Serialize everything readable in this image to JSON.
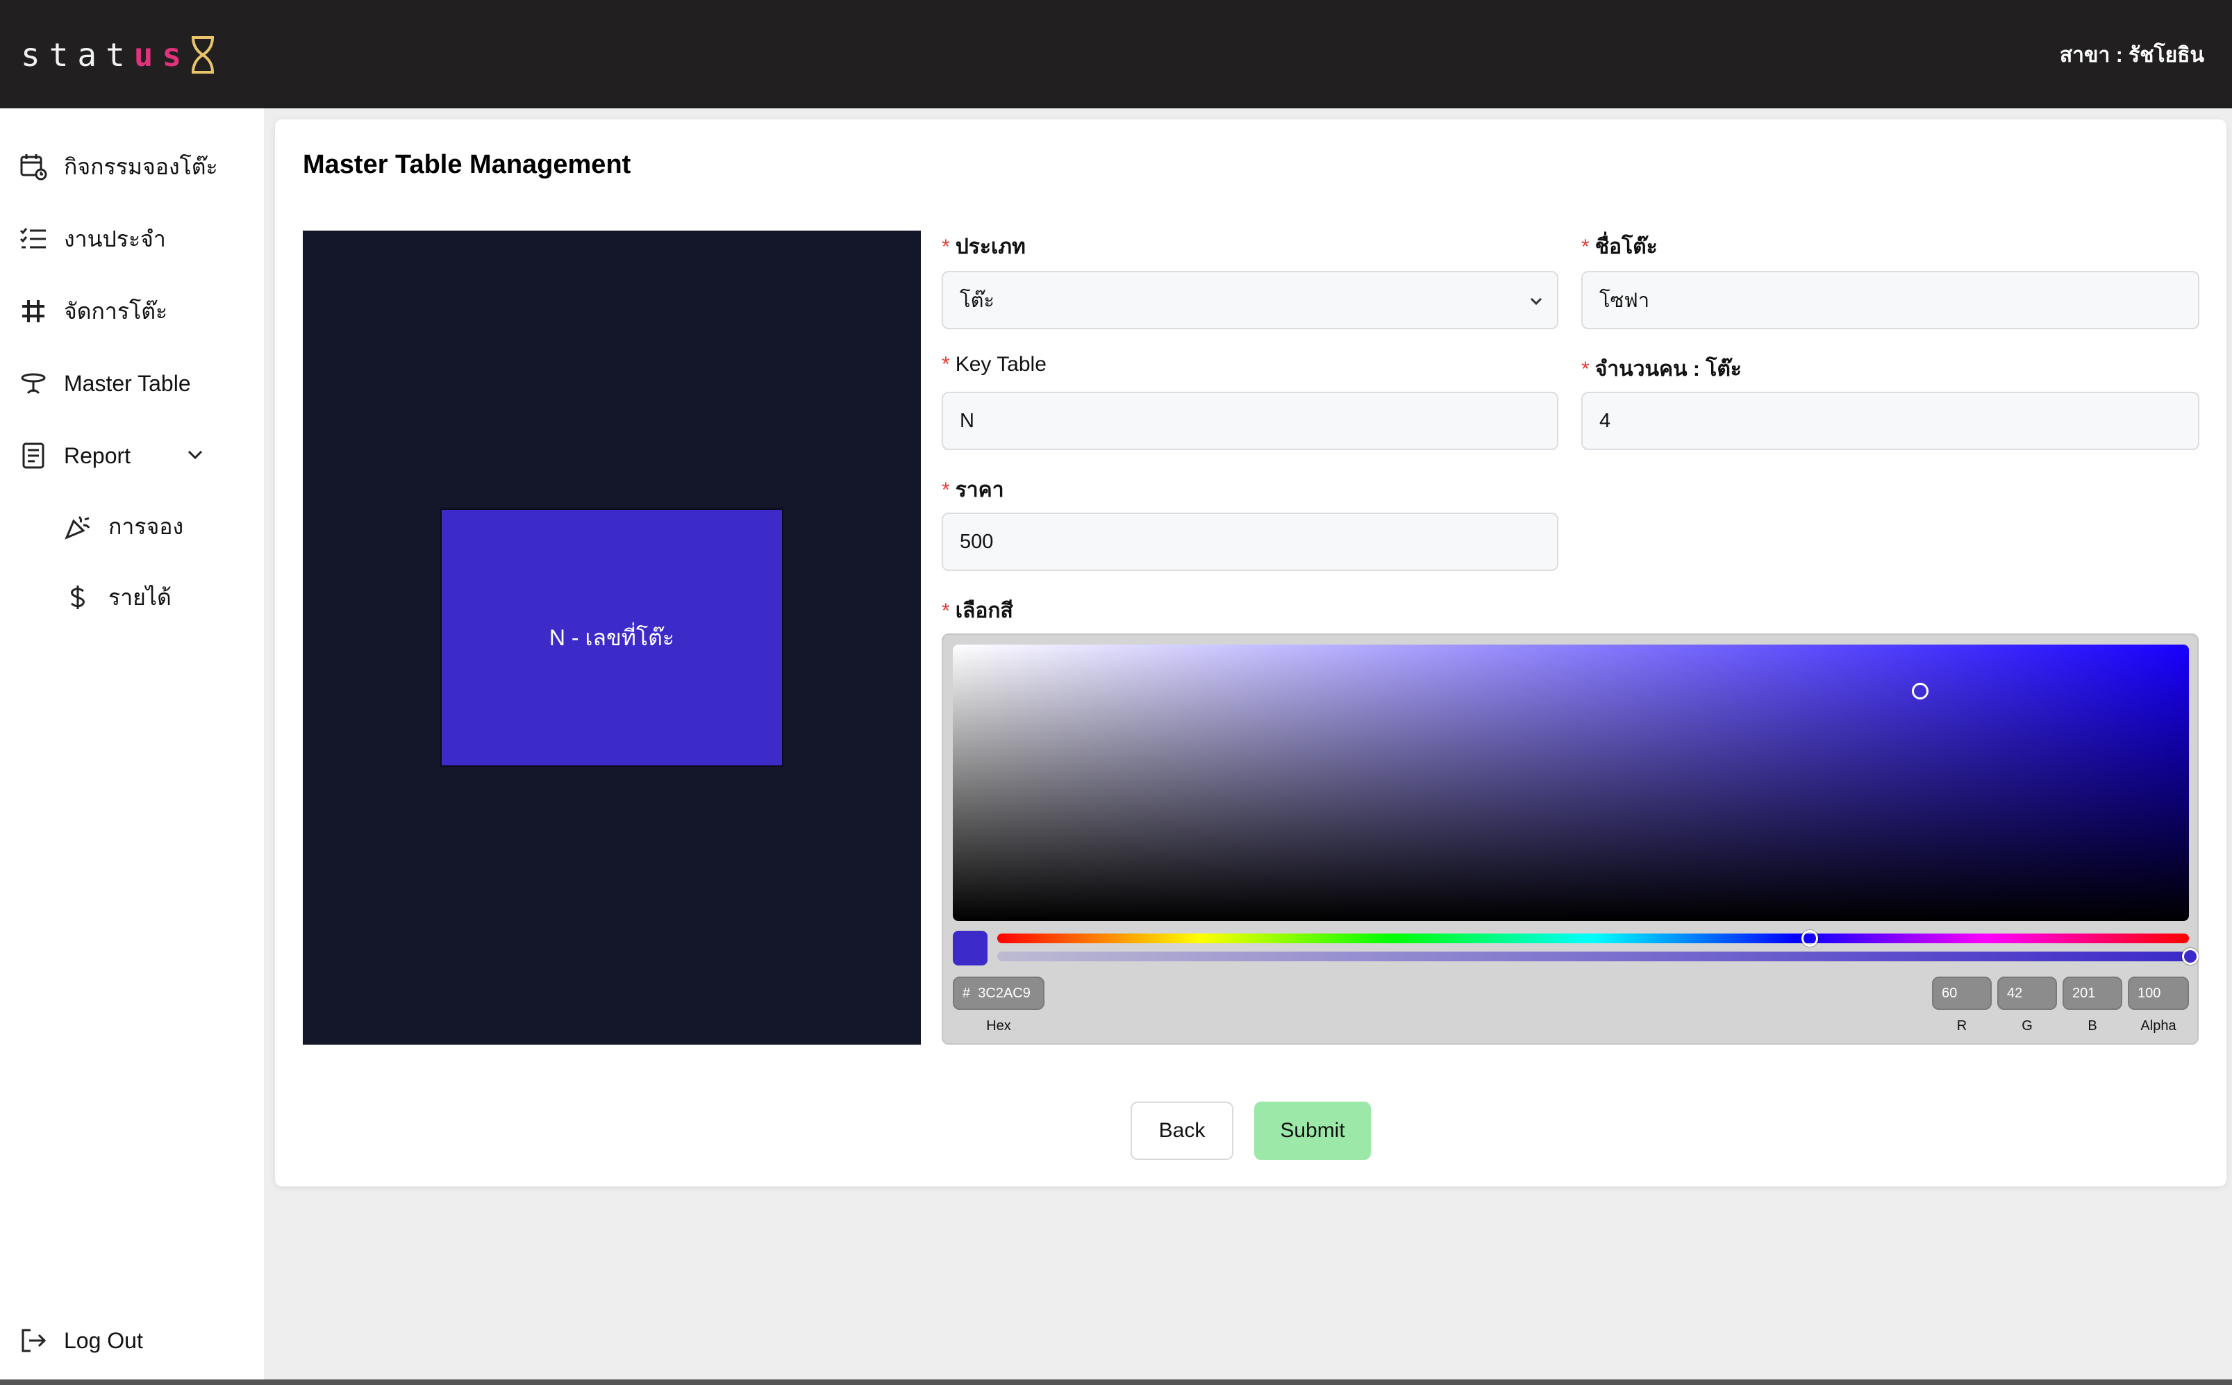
{
  "brand": {
    "logo_text_plain": "stat",
    "logo_text_accent": "us"
  },
  "header": {
    "branch": "สาขา : รัชโยธิน"
  },
  "sidebar": {
    "items": [
      {
        "label": "กิจกรรมจองโต๊ะ",
        "icon": "calendar-clock-icon"
      },
      {
        "label": "งานประจำ",
        "icon": "checklist-icon"
      },
      {
        "label": "จัดการโต๊ะ",
        "icon": "grid-icon"
      },
      {
        "label": "Master Table",
        "icon": "table-icon"
      },
      {
        "label": "Report",
        "icon": "report-icon"
      }
    ],
    "report_sub": [
      {
        "label": "การจอง",
        "icon": "party-popper-icon"
      },
      {
        "label": "รายได้",
        "icon": "dollar-icon"
      }
    ],
    "logout": "Log Out"
  },
  "page": {
    "title": "Master Table Management",
    "preview": {
      "label": "N - เลขที่โต๊ะ",
      "color": "#3c2ac9",
      "background": "#131729"
    },
    "form": {
      "type_label": "ประเภท",
      "type_value": "โต๊ะ",
      "name_label": "ชื่อโต๊ะ",
      "name_value": "โซฟา",
      "key_label": "Key Table",
      "key_value": "N",
      "capacity_label": "จำนวนคน : โต๊ะ",
      "capacity_value": "4",
      "price_label": "ราคา",
      "price_value": "500",
      "color_label": "เลือกสี"
    },
    "color_picker": {
      "hex_prefix": "#",
      "hex": "3C2AC9",
      "hex_caption": "Hex",
      "r": "60",
      "g": "42",
      "b": "201",
      "alpha": "100",
      "r_caption": "R",
      "g_caption": "G",
      "b_caption": "B",
      "alpha_caption": "Alpha"
    },
    "buttons": {
      "back": "Back",
      "submit": "Submit"
    }
  }
}
